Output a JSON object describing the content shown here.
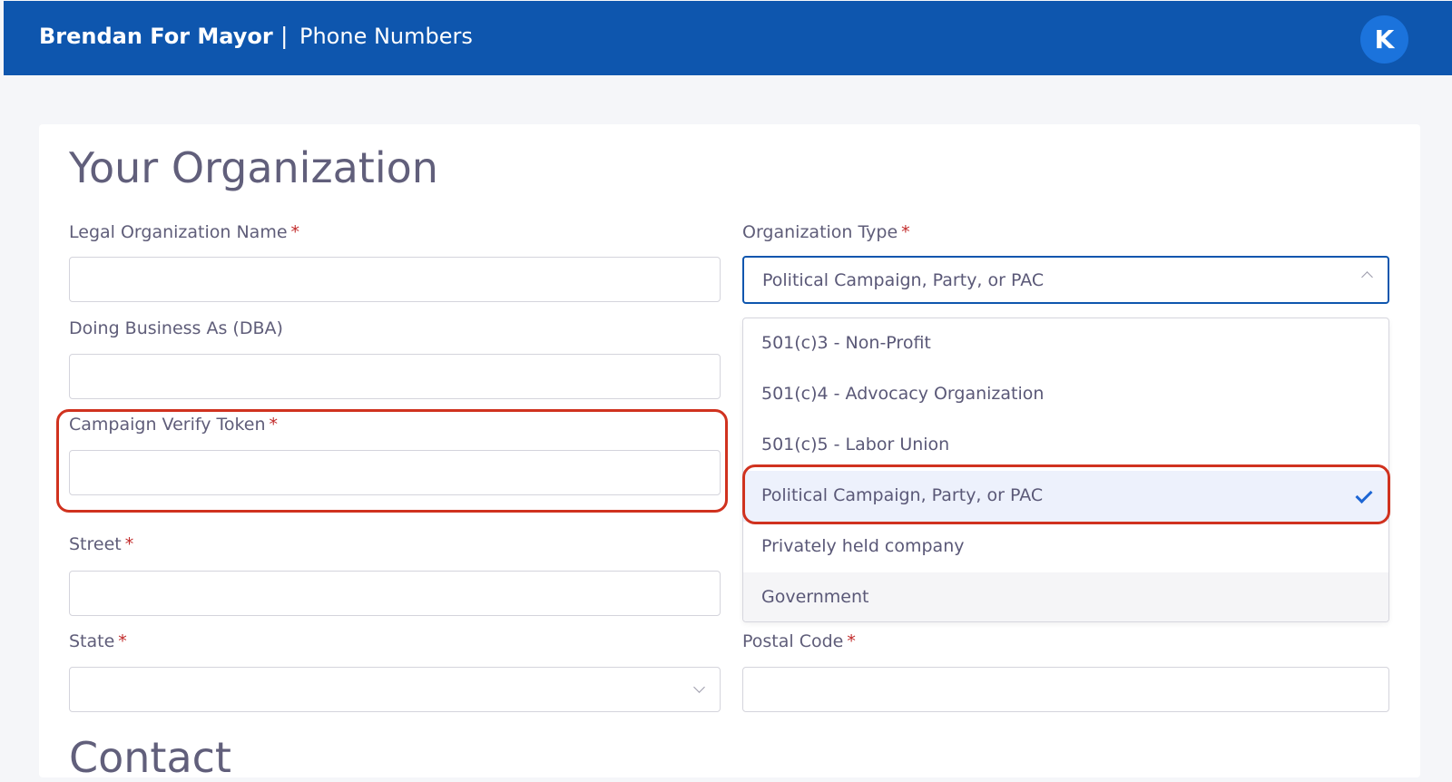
{
  "header": {
    "brand": "Brendan For Mayor",
    "separator": "|",
    "section": "Phone Numbers",
    "avatar_initial": "K"
  },
  "form": {
    "title": "Your Organization",
    "required_marker": "*",
    "legal_name": {
      "label": "Legal Organization Name",
      "value": ""
    },
    "dba": {
      "label": "Doing Business As (DBA)",
      "value": ""
    },
    "campaign_token": {
      "label": "Campaign Verify Token",
      "value": ""
    },
    "street": {
      "label": "Street",
      "value": ""
    },
    "state": {
      "label": "State",
      "value": ""
    },
    "org_type": {
      "label": "Organization Type",
      "selected": "Political Campaign, Party, or PAC",
      "options": [
        "501(c)3 - Non-Profit",
        "501(c)4 - Advocacy Organization",
        "501(c)5 - Labor Union",
        "Political Campaign, Party, or PAC",
        "Privately held company",
        "Government"
      ]
    },
    "postal_code": {
      "label": "Postal Code",
      "value": ""
    },
    "next_section_title": "Contact"
  },
  "colors": {
    "header_bg": "#0e56ae",
    "accent": "#1d66d4",
    "required": "#c22b2b",
    "annotation": "#d0321f"
  }
}
